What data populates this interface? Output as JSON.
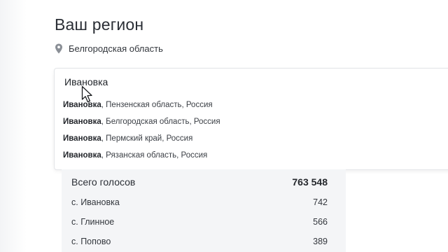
{
  "header": {
    "title": "Ваш регион"
  },
  "current_region": {
    "icon": "map-pin-icon",
    "label": "Белгородская область"
  },
  "search": {
    "value": "Ивановка",
    "placeholder": ""
  },
  "suggestions": [
    {
      "name": "Ивановка",
      "rest": ", Пензенская область, Россия"
    },
    {
      "name": "Ивановка",
      "rest": ", Белгородская область, Россия"
    },
    {
      "name": "Ивановка",
      "rest": ", Пермский край, Россия"
    },
    {
      "name": "Ивановка",
      "rest": ", Рязанская область, Россия"
    }
  ],
  "results": {
    "total_label": "Всего голосов",
    "total_value": "763 548",
    "rows": [
      {
        "label": "с. Ивановка",
        "value": "742"
      },
      {
        "label": "с. Глинное",
        "value": "566"
      },
      {
        "label": "с. Попово",
        "value": "389"
      }
    ]
  },
  "colors": {
    "text": "#2b2f36",
    "panel_bg": "#f4f5f7",
    "border": "#e3e5e8",
    "pin": "#8a8f96"
  }
}
